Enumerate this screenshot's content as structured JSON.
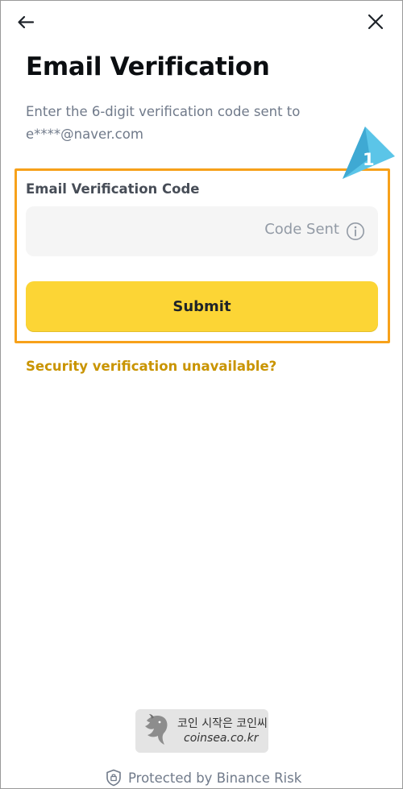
{
  "header": {
    "back_icon": "arrow-left-icon",
    "close_icon": "close-icon"
  },
  "page": {
    "title": "Email Verification",
    "subtitle_line1": "Enter the 6-digit verification code sent to",
    "subtitle_line2": "e****@naver.com"
  },
  "callout": {
    "number": "1",
    "color": "#5bc5e8",
    "highlight_color": "#f7a11a"
  },
  "form": {
    "field_label": "Email Verification Code",
    "code_value": "",
    "code_sent_text": "Code Sent",
    "info_icon": "info-icon",
    "submit_label": "Submit",
    "submit_color": "#fcd535"
  },
  "links": {
    "security_unavailable": "Security verification unavailable?",
    "link_color": "#c99400"
  },
  "watermark": {
    "korean_text": "코인 시작은 코인씨",
    "site": "coinsea.co.kr"
  },
  "footer": {
    "shield_icon": "shield-lock-icon",
    "text": "Protected by Binance Risk"
  }
}
